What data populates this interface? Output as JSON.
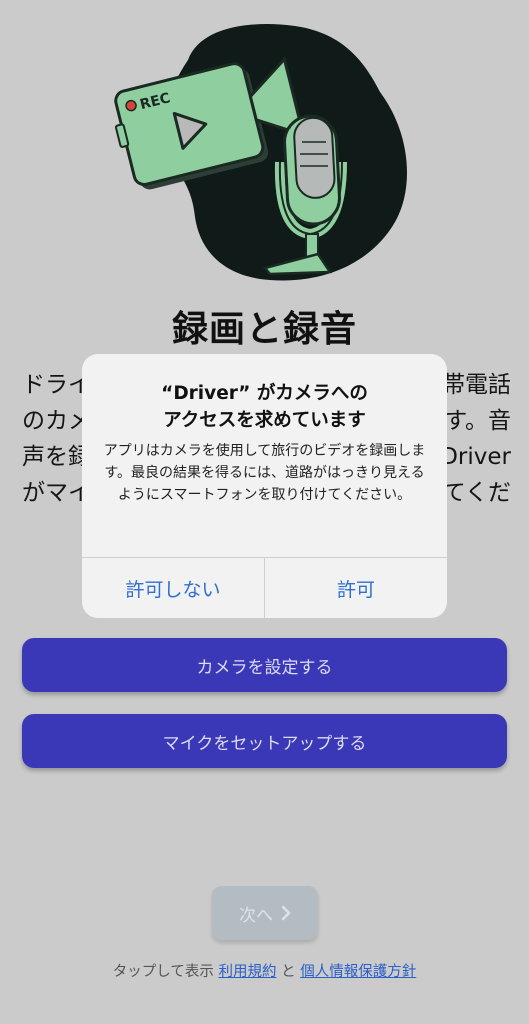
{
  "illustration": {
    "rec_label": "REC"
  },
  "page": {
    "title": "録画と録音",
    "description_lines": [
      [
        "ドライ",
        "帯電話"
      ],
      [
        "のカメ",
        "す。音"
      ],
      [
        "声を録",
        "Driver"
      ],
      [
        "がマイ",
        "てくだ"
      ]
    ]
  },
  "dialog": {
    "title_line1": "“Driver” がカメラへの",
    "title_line2": "アクセスを求めています",
    "message": "アプリはカメラを使用して旅行のビデオを録画します。最良の結果を得るには、道路がはっきり見えるようにスマートフォンを取り付けてください。",
    "deny_label": "許可しない",
    "allow_label": "許可"
  },
  "buttons": {
    "camera_setup": "カメラを設定する",
    "mic_setup": "マイクをセットアップする",
    "next": "次へ"
  },
  "footer": {
    "prefix": "タップして表示",
    "terms": "利用規約",
    "and": "と",
    "privacy": "個人情報保護方針"
  },
  "colors": {
    "background": "#cbcbcb",
    "primary_button": "#3b38b8",
    "illustration_green": "#8fcf9f",
    "link": "#2a5ec8",
    "dialog_action": "#2f6fd3"
  }
}
